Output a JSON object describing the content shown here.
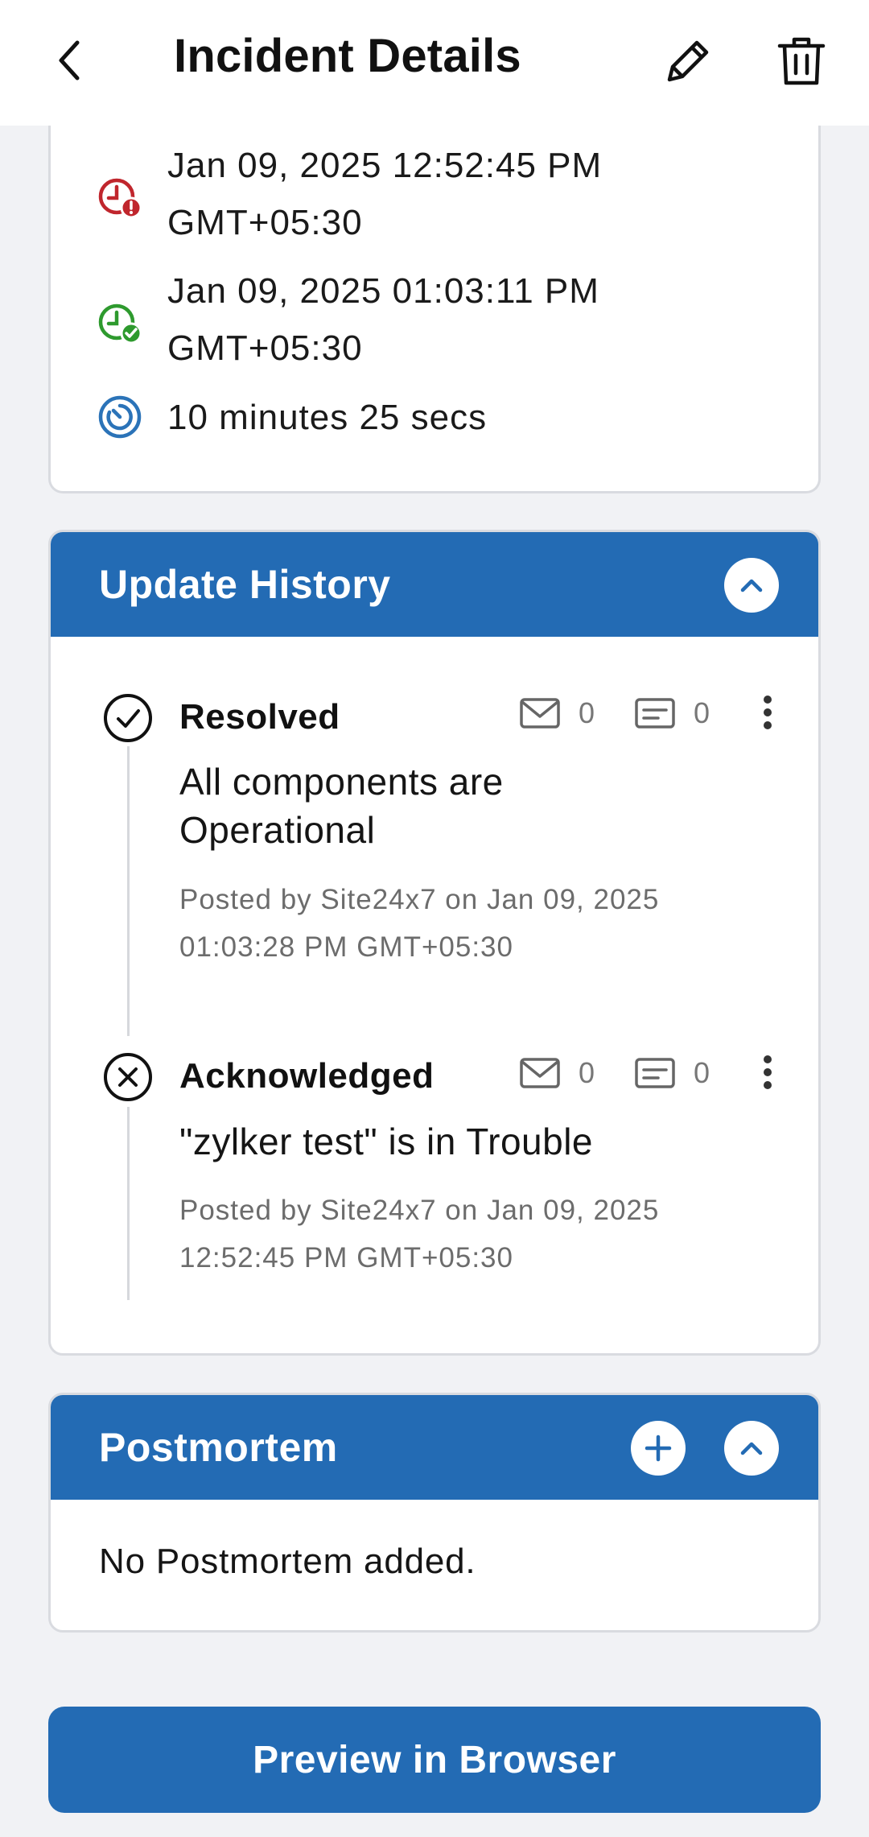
{
  "header": {
    "title": "Incident Details"
  },
  "timing": {
    "started_line1": "Jan 09, 2025 12:52:45 PM",
    "started_line2": "GMT+05:30",
    "resolved_line1": "Jan 09, 2025 01:03:11 PM",
    "resolved_line2": "GMT+05:30",
    "duration": "10 minutes 25 secs"
  },
  "update_history": {
    "title": "Update History",
    "items": [
      {
        "status": "Resolved",
        "mail_count": "0",
        "comment_count": "0",
        "message": "All components are Operational",
        "meta_line1": "Posted by Site24x7 on Jan 09, 2025",
        "meta_line2": "01:03:28 PM GMT+05:30"
      },
      {
        "status": "Acknowledged",
        "mail_count": "0",
        "comment_count": "0",
        "message": "\"zylker test\" is in Trouble",
        "meta_line1": "Posted by Site24x7 on Jan 09, 2025",
        "meta_line2": "12:52:45 PM GMT+05:30"
      }
    ]
  },
  "postmortem": {
    "title": "Postmortem",
    "empty_text": "No Postmortem added."
  },
  "footer": {
    "preview_label": "Preview in Browser"
  },
  "colors": {
    "primary": "#236bb4",
    "danger": "#c0262d",
    "success": "#2e9a2e",
    "info": "#2b73b8"
  }
}
